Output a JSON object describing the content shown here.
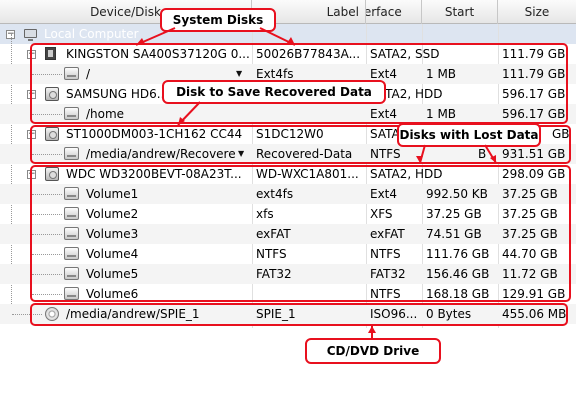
{
  "columns": {
    "device": "Device/Disk",
    "label": "Label",
    "interface": "Interface",
    "start": "Start",
    "size": "Size"
  },
  "root": {
    "label": "Local Computer",
    "icon": "computer-icon"
  },
  "rows": [
    {
      "name": "KINGSTON SA400S37120G 0...",
      "label": "50026B77843A...",
      "iface": "SATA2, SSD",
      "start": "",
      "size": "111.79 GB",
      "icon": "ssd-icon"
    },
    {
      "name": "/",
      "label": "Ext4fs",
      "iface": "Ext4",
      "start": "1 MB",
      "size": "111.79 GB",
      "icon": "volume-icon"
    },
    {
      "name": "SAMSUNG HD6...",
      "label": "",
      "iface": "SATA2, HDD",
      "start": "",
      "size": "596.17 GB",
      "icon": "hdd-icon"
    },
    {
      "name": "/home",
      "label": "",
      "iface": "Ext4",
      "start": "1 MB",
      "size": "596.17 GB",
      "icon": "volume-icon"
    },
    {
      "name": "ST1000DM003-1CH162 CC44",
      "label": "S1DC12W0",
      "iface": "SATA",
      "start": "",
      "size": "GB",
      "icon": "hdd-icon"
    },
    {
      "name": "/media/andrew/Recovere...",
      "label": "Recovered-Data",
      "iface": "NTFS",
      "start": "B",
      "size": "931.51 GB",
      "icon": "volume-icon"
    },
    {
      "name": "WDC WD3200BEVT-08A23T...",
      "label": "WD-WXC1A801...",
      "iface": "SATA2, HDD",
      "start": "",
      "size": "298.09 GB",
      "icon": "hdd-icon"
    },
    {
      "name": "Volume1",
      "label": "ext4fs",
      "iface": "Ext4",
      "start": "992.50 KB",
      "size": "37.25 GB",
      "icon": "volume-icon"
    },
    {
      "name": "Volume2",
      "label": "xfs",
      "iface": "XFS",
      "start": "37.25 GB",
      "size": "37.25 GB",
      "icon": "volume-icon"
    },
    {
      "name": "Volume3",
      "label": "exFAT",
      "iface": "exFAT",
      "start": "74.51 GB",
      "size": "37.25 GB",
      "icon": "volume-icon"
    },
    {
      "name": "Volume4",
      "label": "NTFS",
      "iface": "NTFS",
      "start": "111.76 GB",
      "size": "44.70 GB",
      "icon": "volume-icon"
    },
    {
      "name": "Volume5",
      "label": "FAT32",
      "iface": "FAT32",
      "start": "156.46 GB",
      "size": "11.72 GB",
      "icon": "volume-icon"
    },
    {
      "name": "Volume6",
      "label": "",
      "iface": "NTFS",
      "start": "168.18 GB",
      "size": "129.91 GB",
      "icon": "volume-icon"
    },
    {
      "name": "/media/andrew/SPIE_1",
      "label": "SPIE_1",
      "iface": "ISO96...",
      "start": "0 Bytes",
      "size": "455.06 MB",
      "icon": "cd-icon"
    }
  ],
  "callouts": {
    "system_disks": "System Disks",
    "save_recovered": "Disk to Save Recovered Data",
    "lost_data": "Disks with Lost Data",
    "cd_dvd": "CD/DVD Drive"
  },
  "colors": {
    "annotation": "#e8101e",
    "root_row": "#dde5f1",
    "root_text": "#ffffff"
  }
}
